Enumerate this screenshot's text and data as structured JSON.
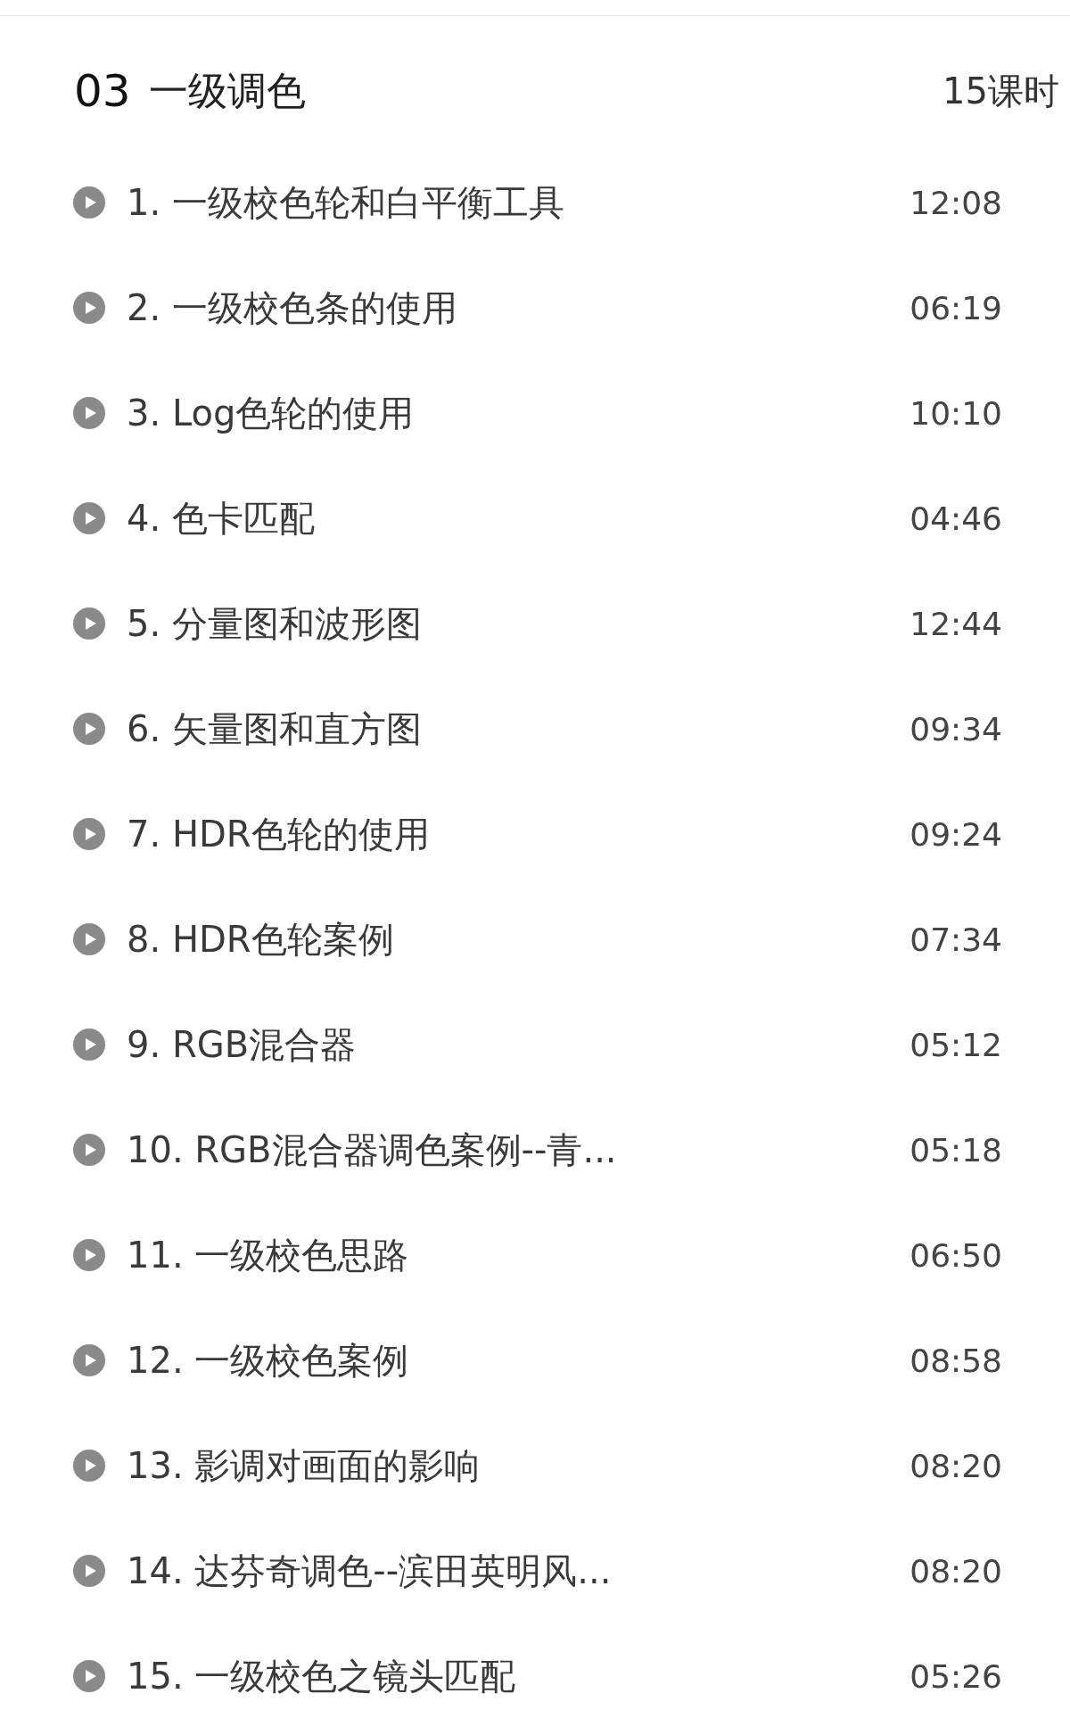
{
  "section": {
    "number": "03",
    "title": "一级调色",
    "lesson_count": "15课时"
  },
  "lessons": [
    {
      "title": "1. 一级校色轮和白平衡工具",
      "duration": "12:08"
    },
    {
      "title": "2. 一级校色条的使用",
      "duration": "06:19"
    },
    {
      "title": "3. Log色轮的使用",
      "duration": "10:10"
    },
    {
      "title": "4. 色卡匹配",
      "duration": "04:46"
    },
    {
      "title": "5. 分量图和波形图",
      "duration": "12:44"
    },
    {
      "title": "6. 矢量图和直方图",
      "duration": "09:34"
    },
    {
      "title": "7. HDR色轮的使用",
      "duration": "09:24"
    },
    {
      "title": "8. HDR色轮案例",
      "duration": "07:34"
    },
    {
      "title": "9. RGB混合器",
      "duration": "05:12"
    },
    {
      "title": "10. RGB混合器调色案例--青...",
      "duration": "05:18"
    },
    {
      "title": "11. 一级校色思路",
      "duration": "06:50"
    },
    {
      "title": "12. 一级校色案例",
      "duration": "08:58"
    },
    {
      "title": "13. 影调对画面的影响",
      "duration": "08:20"
    },
    {
      "title": "14. 达芬奇调色--滨田英明风...",
      "duration": "08:20"
    },
    {
      "title": "15. 一级校色之镜头匹配",
      "duration": "05:26"
    }
  ]
}
